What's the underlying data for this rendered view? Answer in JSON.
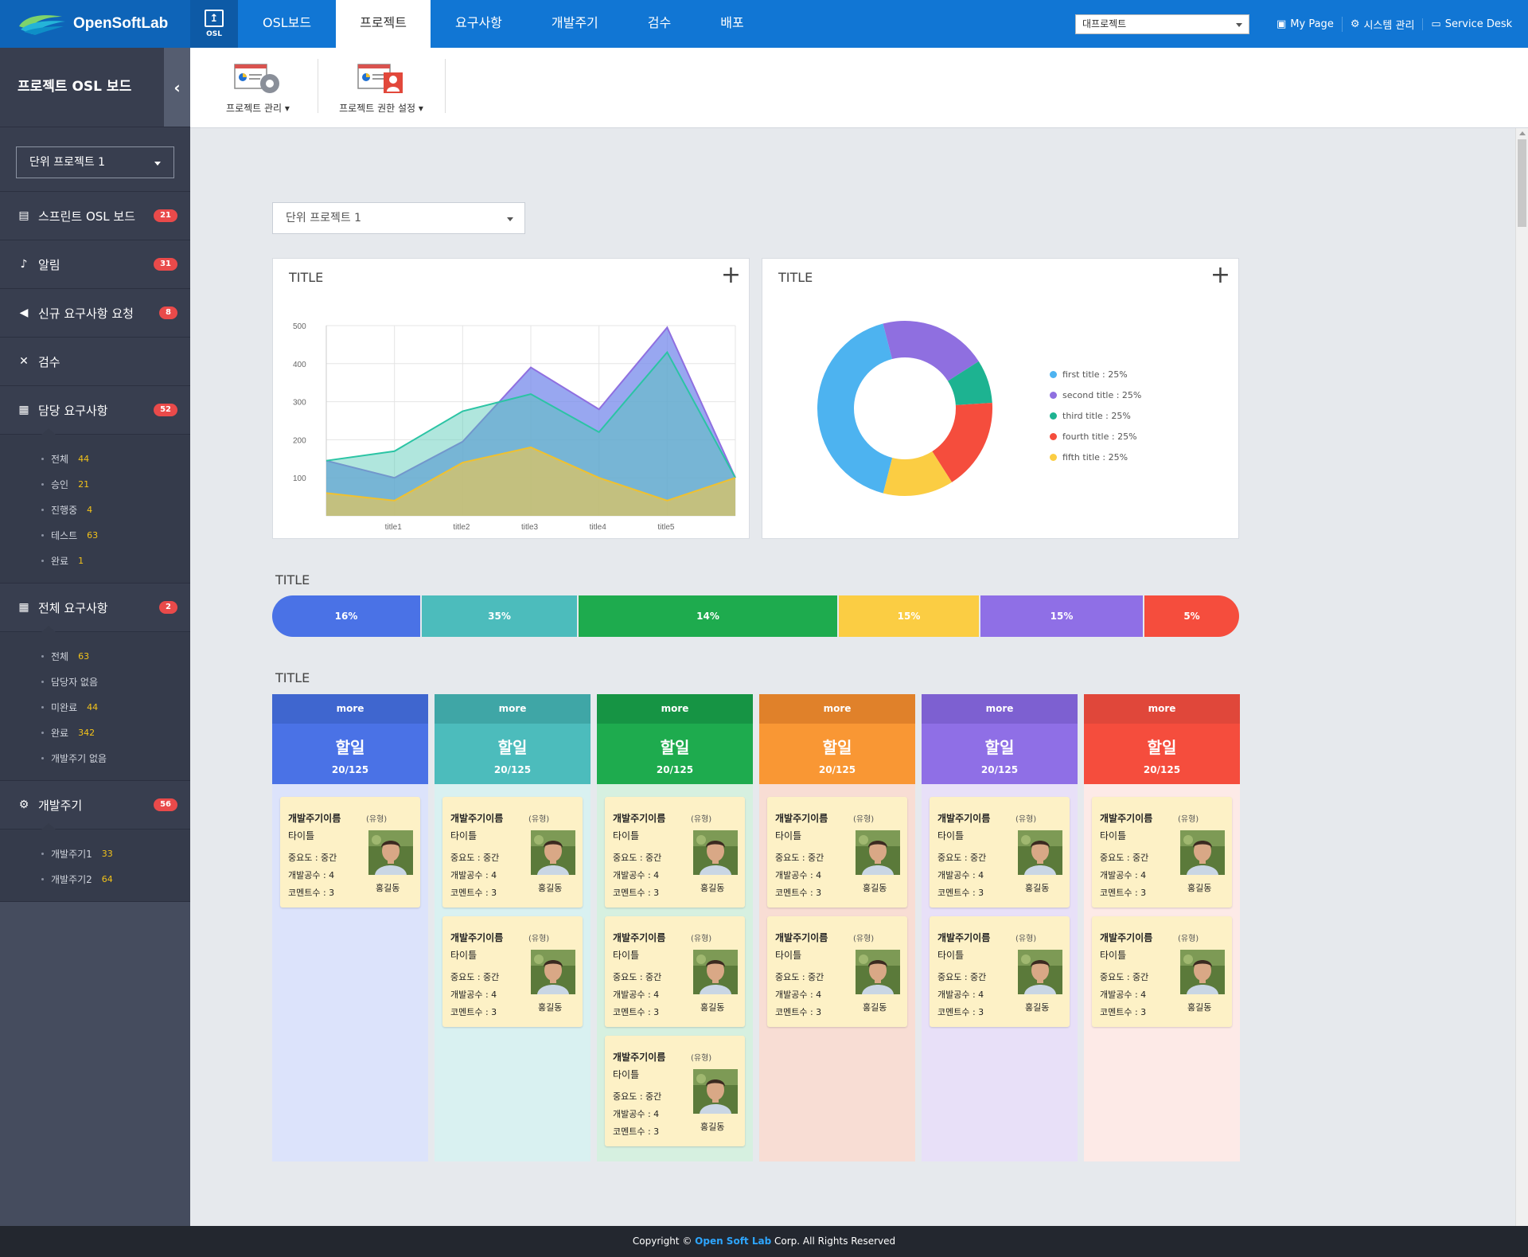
{
  "header": {
    "logo_text": "OpenSoftLab",
    "osl_label": "OSL",
    "menu": [
      {
        "label": "OSL보드"
      },
      {
        "label": "프로젝트"
      },
      {
        "label": "요구사항"
      },
      {
        "label": "개발주기"
      },
      {
        "label": "검수"
      },
      {
        "label": "배포"
      }
    ],
    "project_select_value": "대프로젝트",
    "links": [
      {
        "label": "My Page",
        "icon": "building-icon"
      },
      {
        "label": "시스템 관리",
        "icon": "gear-icon"
      },
      {
        "label": "Service Desk",
        "icon": "monitor-icon"
      }
    ]
  },
  "sidebar": {
    "title": "프로젝트 OSL 보드",
    "select_value": "단위 프로젝트 1",
    "items": [
      {
        "label": "스프린트 OSL 보드",
        "badge": "21",
        "icon": "book-icon"
      },
      {
        "label": "알림",
        "badge": "31",
        "icon": "bell-icon"
      },
      {
        "label": "신규 요구사항 요청",
        "badge": "8",
        "icon": "megaphone-icon"
      },
      {
        "label": "검수",
        "badge": "",
        "icon": "tools-icon"
      },
      {
        "label": "담당 요구사항",
        "badge": "52",
        "icon": "briefcase-icon",
        "sub": [
          {
            "label": "전체",
            "count": "44"
          },
          {
            "label": "승인",
            "count": "21"
          },
          {
            "label": "진행중",
            "count": "4"
          },
          {
            "label": "테스트",
            "count": "63"
          },
          {
            "label": "완료",
            "count": "1"
          }
        ]
      },
      {
        "label": "전체 요구사항",
        "badge": "2",
        "icon": "calendar-icon",
        "sub": [
          {
            "label": "전체",
            "count": "63"
          },
          {
            "label": "담당자 없음",
            "count": ""
          },
          {
            "label": "미완료",
            "count": "44"
          },
          {
            "label": "완료",
            "count": "342"
          },
          {
            "label": "개발주기 없음",
            "count": ""
          }
        ]
      },
      {
        "label": "개발주기",
        "badge": "56",
        "icon": "gear-icon",
        "sub": [
          {
            "label": "개발주기1",
            "count": "33"
          },
          {
            "label": "개발주기2",
            "count": "64"
          }
        ]
      }
    ]
  },
  "toolbar": {
    "buttons": [
      {
        "label": "프로젝트 관리"
      },
      {
        "label": "프로젝트 권한 설정"
      }
    ]
  },
  "main": {
    "select_value": "단위 프로젝트 1",
    "area_panel_title": "TITLE",
    "donut_panel_title": "TITLE",
    "progress_title": "TITLE",
    "kanban_title": "TITLE"
  },
  "chart_data": [
    {
      "type": "area",
      "title": "TITLE",
      "categories": [
        "title1",
        "title2",
        "title3",
        "title4",
        "title5"
      ],
      "x": [
        0,
        0.5,
        1,
        1.5,
        2,
        2.5,
        3,
        3.5,
        4,
        4.5,
        5,
        5.5,
        6
      ],
      "y_ticks": [
        100,
        200,
        300,
        400,
        500
      ],
      "ylim": [
        0,
        500
      ],
      "series": [
        {
          "color": "#8f6fe0",
          "values": [
            145,
            100,
            195,
            390,
            280,
            495,
            100
          ]
        },
        {
          "color": "#2bc4a4",
          "values": [
            145,
            170,
            275,
            320,
            220,
            430,
            100
          ]
        },
        {
          "color": "#f0c12f",
          "values": [
            60,
            40,
            140,
            180,
            100,
            40,
            100
          ]
        }
      ]
    },
    {
      "type": "pie",
      "title": "TITLE",
      "slices": [
        {
          "label": "first title : 25%",
          "value": 42,
          "color": "#4db3f0"
        },
        {
          "label": "second title : 25%",
          "value": 20,
          "color": "#8f6fe0"
        },
        {
          "label": "third title : 25%",
          "value": 8,
          "color": "#1db391"
        },
        {
          "label": "fourth title : 25%",
          "value": 17,
          "color": "#f54d3d"
        },
        {
          "label": "fifth title : 25%",
          "value": 13,
          "color": "#fbcd43"
        }
      ]
    },
    {
      "type": "bar",
      "title": "TITLE",
      "segments": [
        {
          "label": "16%",
          "value": 16,
          "color": "#4a72e6"
        },
        {
          "label": "35%",
          "value": 35,
          "color": "#4cbcbc"
        },
        {
          "label": "14%",
          "value": 14,
          "color": "#1eab4e"
        },
        {
          "label": "15%",
          "value": 15,
          "color": "#fbcd43"
        },
        {
          "label": "15%",
          "value": 15,
          "color": "#8f6fe6"
        },
        {
          "label": "5%",
          "value": 5,
          "color": "#f54d3d"
        }
      ]
    }
  ],
  "kanban": {
    "columns": [
      {
        "more": "more",
        "title": "할일",
        "count": "20/125",
        "more_color": "#3f66cf",
        "head_color": "#4a72e6",
        "body_color": "#dce3fb",
        "cards": 1
      },
      {
        "more": "more",
        "title": "할일",
        "count": "20/125",
        "more_color": "#3fa6a6",
        "head_color": "#4cbcbc",
        "body_color": "#d9f1f1",
        "cards": 2
      },
      {
        "more": "more",
        "title": "할일",
        "count": "20/125",
        "more_color": "#169444",
        "head_color": "#1eab4e",
        "body_color": "#d6f0e0",
        "cards": 3
      },
      {
        "more": "more",
        "title": "할일",
        "count": "20/125",
        "more_color": "#e0812a",
        "head_color": "#f99734",
        "body_color": "#f8ddd4",
        "cards": 2
      },
      {
        "more": "more",
        "title": "할일",
        "count": "20/125",
        "more_color": "#7d60d1",
        "head_color": "#8f6fe6",
        "body_color": "#e8e0f8",
        "cards": 2
      },
      {
        "more": "more",
        "title": "할일",
        "count": "20/125",
        "more_color": "#e0473a",
        "head_color": "#f54d3d",
        "body_color": "#fdeae7",
        "cards": 2
      }
    ],
    "card": {
      "name": "개발주기이름",
      "type": "(유형)",
      "title": "타이틀",
      "importance": "중요도 : 중간",
      "effort": "개발공수 : 4",
      "comments": "코멘트수 : 3",
      "user": "홍길동"
    }
  },
  "footer": {
    "prefix": "Copyright ©",
    "brand": "Open Soft Lab",
    "suffix": "Corp. All Rights Reserved"
  }
}
